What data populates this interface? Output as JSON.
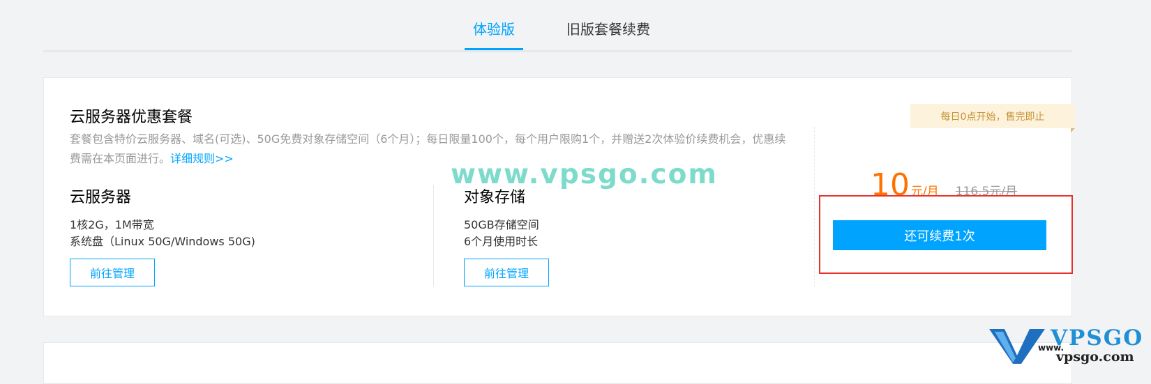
{
  "tabs": [
    {
      "label": "体验版",
      "active": true
    },
    {
      "label": "旧版套餐续费",
      "active": false
    }
  ],
  "package": {
    "title": "云服务器优惠套餐",
    "description": "套餐包含特价云服务器、域名(可选)、50G免费对象存储空间（6个月）；每日限量100个，每个用户限购1个，并赠送2次体验价续费机会，优惠续费需在本页面进行。",
    "rule_link": "详细规则>>",
    "badge": "每日0点开始，售完即止",
    "server": {
      "title": "云服务器",
      "lines": [
        "1核2G，1M带宽",
        "系统盘（Linux 50G/Windows 50G)"
      ],
      "button": "前往管理"
    },
    "storage": {
      "title": "对象存储",
      "lines": [
        "50GB存储空间",
        "6个月使用时长"
      ],
      "button": "前往管理"
    },
    "price": {
      "amount": "10",
      "unit": "元/月",
      "original": "116.5元/月"
    },
    "renew_button": "还可续费1次"
  },
  "watermarks": {
    "center": "www.vpsgo.com",
    "logo_brand": "VPSGO",
    "logo_url_small": "www.",
    "logo_url": "vpsgo.com"
  },
  "colors": {
    "accent": "#00a4ff",
    "price": "#ff7200",
    "highlight_box": "#e8302c",
    "badge_bg": "#fdf3dc"
  }
}
